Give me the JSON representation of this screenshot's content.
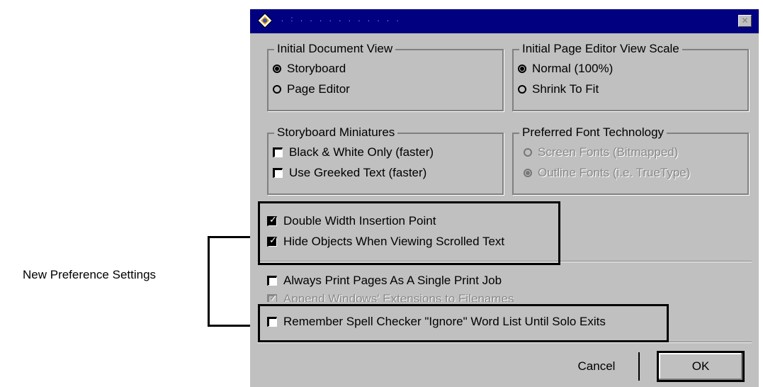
{
  "callout": {
    "label": "New Preference Settings"
  },
  "dialog": {
    "title": ". : .   .  .  . . . . . . .  .",
    "close_symbol": "✕",
    "initial_document_view": {
      "title": "Initial Document View",
      "options": [
        "Storyboard",
        "Page Editor"
      ],
      "selected": "Storyboard"
    },
    "initial_page_editor_view_scale": {
      "title": "Initial Page Editor View Scale",
      "options": [
        "Normal (100%)",
        "Shrink To Fit"
      ],
      "selected": "Normal (100%)"
    },
    "storyboard_miniatures": {
      "title": "Storyboard Miniatures",
      "options": [
        "Black & White Only (faster)",
        "Use Greeked Text (faster)"
      ],
      "checked": [
        false,
        false
      ]
    },
    "preferred_font_technology": {
      "title": "Preferred Font Technology",
      "options": [
        "Screen Fonts (Bitmapped)",
        "Outline Fonts (i.e. TrueType)"
      ],
      "selected": "Outline Fonts (i.e. TrueType)",
      "disabled": true
    },
    "new_settings": [
      {
        "label": "Double Width Insertion Point",
        "checked": true
      },
      {
        "label": "Hide Objects When Viewing Scrolled Text",
        "checked": true
      }
    ],
    "print_settings": [
      {
        "label": "Always Print Pages As A Single Print Job",
        "checked": false,
        "disabled": false
      },
      {
        "label": "Append Windows' Extensions to Filenames",
        "checked": true,
        "disabled": true
      },
      {
        "label": "Remember Spell Checker \"Ignore\" Word List Until Solo Exits",
        "checked": false,
        "disabled": false
      }
    ],
    "buttons": {
      "cancel": "Cancel",
      "ok": "OK"
    }
  }
}
